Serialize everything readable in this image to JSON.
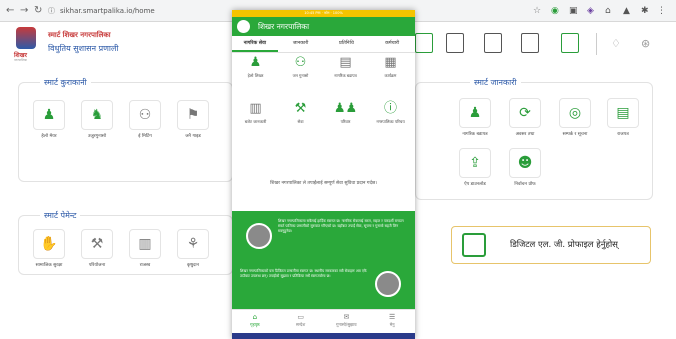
{
  "browser": {
    "url": "sikhar.smartpalika.io/home"
  },
  "site": {
    "title_line1": "स्मार्ट शिखर नगरपालिका",
    "title_line2": "विधुतिय सुशासन प्रणाली",
    "logo_text": "शिखर",
    "logo_tiny": "नगरपालिका"
  },
  "panels": {
    "left_top_title": "स्मार्ट कुराकानी",
    "left_top_items": [
      "हेलो मेयर",
      "उजुरगुनासो",
      "ई मिटिंग",
      "जनै गाइड"
    ],
    "left_bottom_title": "स्मार्ट पेमेन्ट",
    "left_bottom_items": [
      "सामाजिक सुरक्षा",
      "परियोजना",
      "राजस्व",
      "कृषुदान"
    ],
    "right_top_title": "स्मार्ट जानकारी",
    "right_top_items": [
      "नागरिक बडापत्र",
      "अवसर तथा",
      "सम्पर्क र सूचना",
      "राजपत्र",
      "ऐप डाउनलोड",
      "निर्वाचन प्रोफ"
    ],
    "right_banner": "डिजिटल एल. जी. प्रोफाइल हेर्नुहोस्"
  },
  "app": {
    "status_text": "10:45 PM · फोन · 100%",
    "title": "शिखर नगरपालिका",
    "tabs": [
      "नागरिक सेवा",
      "जानकारी",
      "प्रतिनिधि",
      "कर्मचारी"
    ],
    "grid": [
      {
        "label": "हेलो शिखर",
        "icon": "person-icon"
      },
      {
        "label": "जन गुनासो",
        "icon": "chat-icon"
      },
      {
        "label": "नागरिक बडापत्र",
        "icon": "document-icon"
      },
      {
        "label": "कार्यक्रम",
        "icon": "calendar-icon"
      },
      {
        "label": "बजेट जानकारी",
        "icon": "building-icon"
      },
      {
        "label": "सेवा",
        "icon": "service-icon"
      },
      {
        "label": "परिवार",
        "icon": "group-icon"
      },
      {
        "label": "नगरपालिका परिचय",
        "icon": "info-icon"
      }
    ],
    "note": "शिखर नगरपालिका ले तपाईंलाई सम्पूर्ण सेवा सुविधा प्रदान गर्दछ।",
    "message1": "शिखर नगरपालिकामा सबैलाई हार्दिक स्वागत छ। नागरिक सेवालाई सरल, सहज र पारदर्शी बनाउन स्मार्ट पालिका प्रणालीको सुरुवात गरिएको छ। यहाँबाट तपाईं सेवा, सूचना र गुनासो सहजै लिन सक्नुहुनेछ।",
    "message2": "शिखर नगरपालिकाको यस डिजिटल प्रणालीमा स्वागत छ। स्थानीय सरकारका सबै सेवाहरू अब एकै ठाउँबाट उपलब्ध छन्। तपाईंको सुझाव र प्रतिक्रिया सधैं स्वागतयोग्य छ।",
    "bottom_nav": [
      "गृहपृष्ठ",
      "सन्देश",
      "गुनासो/सुझाव",
      "मेनु"
    ]
  }
}
